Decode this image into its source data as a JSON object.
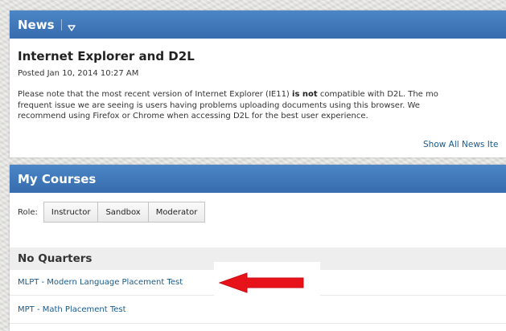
{
  "news": {
    "header": "News",
    "article_title": "Internet Explorer and D2L",
    "posted": "Posted Jan 10, 2014 10:27 AM",
    "body": {
      "line1_before": "Please note that the most recent version of Internet Explorer (IE11) ",
      "line1_bold": "is not",
      "line1_after": " compatible with D2L.  The mo",
      "line2": "frequent issue we are seeing is users having problems uploading documents using this browser.  We",
      "line3": "recommend using Firefox or Chrome when accessing D2L for the best user experience."
    },
    "show_all": "Show All News Ite"
  },
  "courses": {
    "header": "My Courses",
    "role_label": "Role:",
    "roles": [
      "Instructor",
      "Sandbox",
      "Moderator"
    ],
    "group_title": "No Quarters",
    "items": [
      "MLPT - Modern Language Placement Test",
      "MPT - Math Placement Test"
    ]
  },
  "colors": {
    "header_blue": "#3f77b8",
    "link": "#1b5a8a",
    "arrow": "#e8121b"
  }
}
